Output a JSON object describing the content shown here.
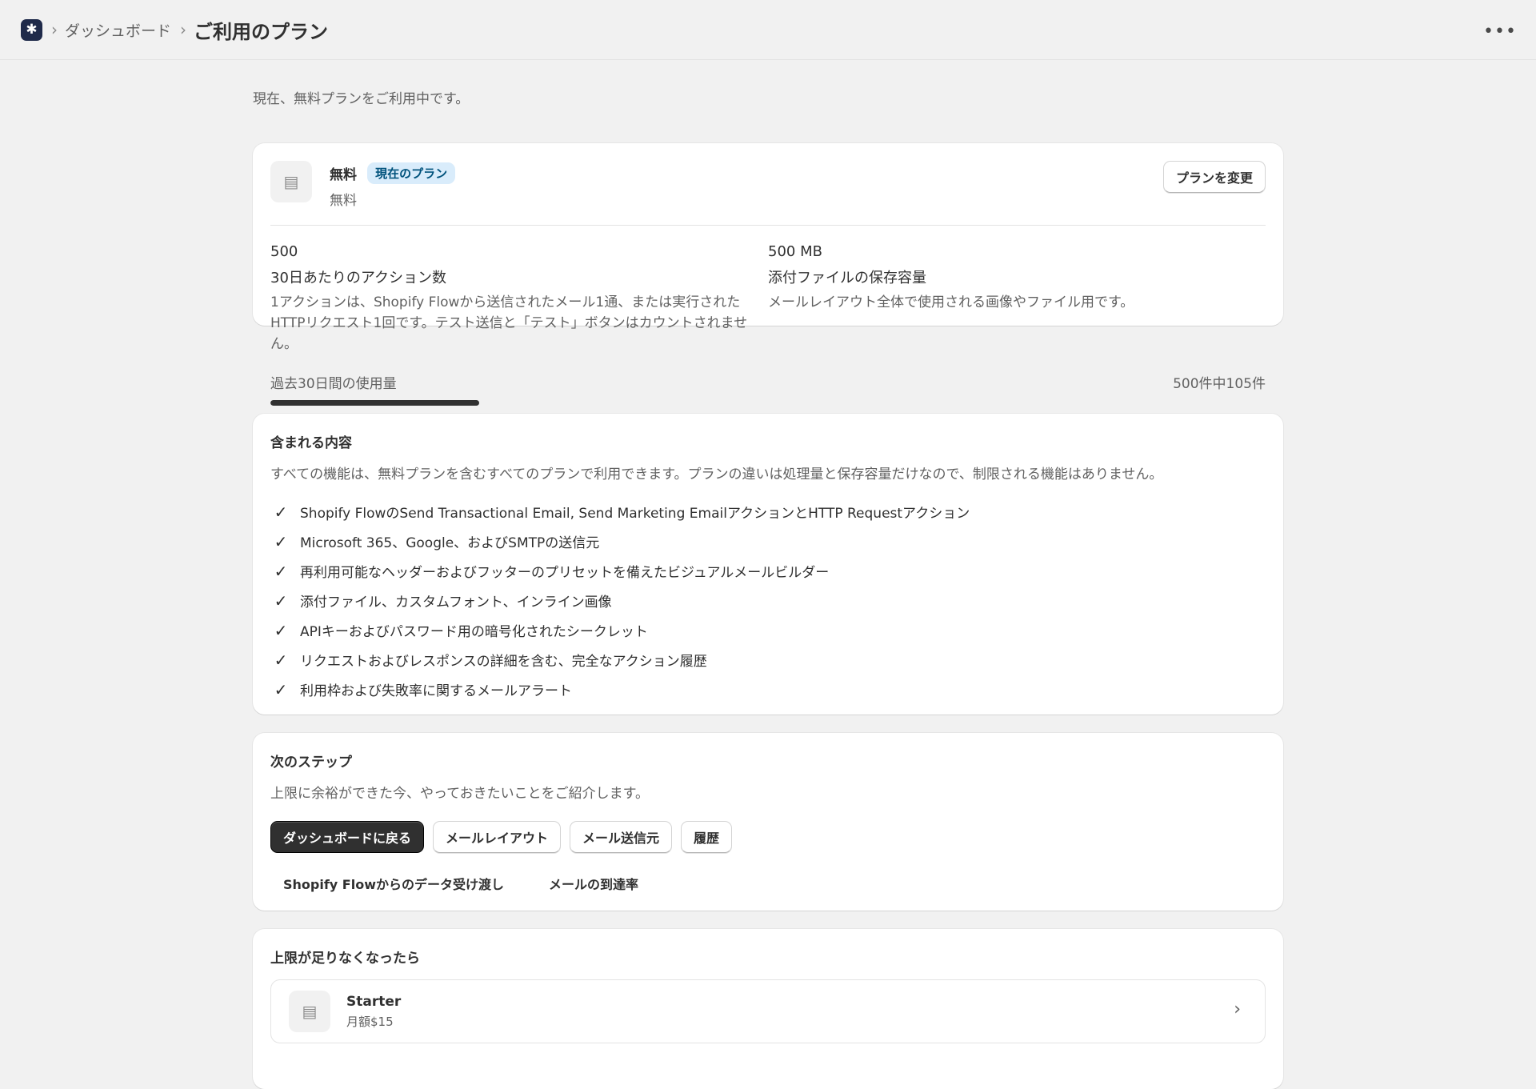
{
  "topbar": {
    "app_icon_glyph": "✱",
    "crumb_separator": "›",
    "breadcrumb_dashboard": "ダッシュボード",
    "page_title": "ご利用のプラン",
    "more_icon_glyph": "•••"
  },
  "intro": "現在、無料プランをご利用中です。",
  "current_plan": {
    "icon_glyph": "▤",
    "name": "無料",
    "badge": "現在のプラン",
    "price": "無料",
    "change_button": "プランを変更",
    "actions_value": "500",
    "actions_label": "30日あたりのアクション数",
    "actions_desc": "1アクションは、Shopify Flowから送信されたメール1通、または実行されたHTTPリクエスト1回です。テスト送信と「テスト」ボタンはカウントされません。",
    "storage_value": "500 MB",
    "storage_label": "添付ファイルの保存容量",
    "storage_desc": "メールレイアウト全体で使用される画像やファイル用です。",
    "usage_label": "過去30日間の使用量",
    "usage_count": "500件中105件",
    "usage_fraction": 0.21
  },
  "included": {
    "title": "含まれる内容",
    "description": "すべての機能は、無料プランを含むすべてのプランで利用できます。プランの違いは処理量と保存容量だけなので、制限される機能はありません。",
    "check_glyph": "✓",
    "features": [
      "Shopify FlowのSend Transactional Email, Send Marketing EmailアクションとHTTP Requestアクション",
      "Microsoft 365、Google、およびSMTPの送信元",
      "再利用可能なヘッダーおよびフッターのプリセットを備えたビジュアルメールビルダー",
      "添付ファイル、カスタムフォント、インライン画像",
      "APIキーおよびパスワード用の暗号化されたシークレット",
      "リクエストおよびレスポンスの詳細を含む、完全なアクション履歴",
      "利用枠および失敗率に関するメールアラート"
    ]
  },
  "next_steps": {
    "title": "次のステップ",
    "description": "上限に余裕ができた今、やっておきたいことをご紹介します。",
    "buttons": [
      "ダッシュボードに戻る",
      "メールレイアウト",
      "メール送信元",
      "履歴"
    ],
    "links": [
      "Shopify Flowからのデータ受け渡し",
      "メールの到達率"
    ]
  },
  "upgrade": {
    "title": "上限が足りなくなったら",
    "icon_glyph": "▤",
    "chevron_glyph": "›",
    "plan_name": "Starter",
    "plan_price": "月額$15"
  }
}
